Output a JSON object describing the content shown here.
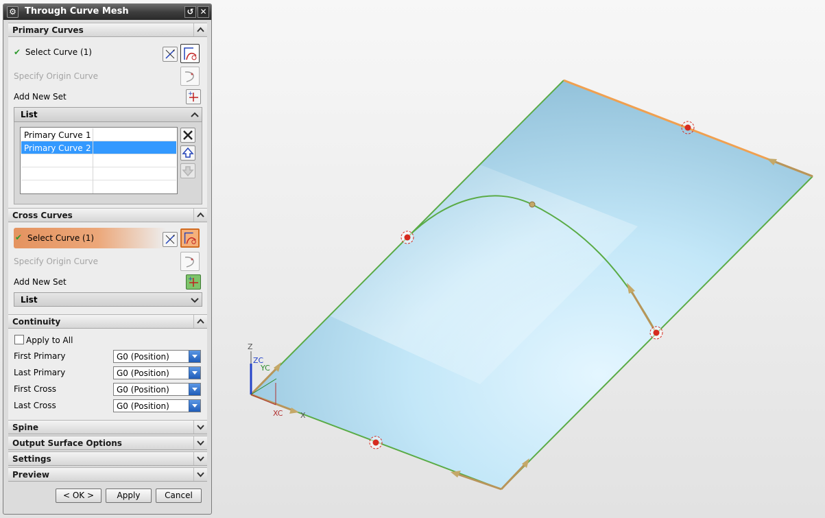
{
  "dialog": {
    "title": "Through Curve Mesh",
    "primary_curves": {
      "header": "Primary Curves",
      "select_curve": "Select Curve (1)",
      "specify_origin": "Specify Origin Curve",
      "add_new_set": "Add New Set",
      "list_header": "List",
      "list_rows": [
        {
          "name": "Primary Curve",
          "num": "1"
        },
        {
          "name": "Primary Curve",
          "num": "2"
        }
      ]
    },
    "cross_curves": {
      "header": "Cross Curves",
      "select_curve": "Select Curve (1)",
      "specify_origin": "Specify Origin Curve",
      "add_new_set": "Add New Set",
      "list_header": "List"
    },
    "continuity": {
      "header": "Continuity",
      "apply_all": "Apply to All",
      "rows": [
        {
          "label": "First Primary",
          "value": "G0 (Position)"
        },
        {
          "label": "Last Primary",
          "value": "G0 (Position)"
        },
        {
          "label": "First Cross",
          "value": "G0 (Position)"
        },
        {
          "label": "Last Cross",
          "value": "G0 (Position)"
        }
      ]
    },
    "collapsed_sections": [
      "Spine",
      "Output Surface Options",
      "Settings",
      "Preview"
    ],
    "buttons": {
      "ok": "< OK >",
      "apply": "Apply",
      "cancel": "Cancel"
    }
  },
  "viewport": {
    "axes": {
      "z": "Z",
      "zc": "ZC",
      "yc": "YC",
      "xc": "XC",
      "x": "X"
    },
    "colors": {
      "surface": "#bfe4f7",
      "edge": "#5aab46",
      "selected_edge": "#f0a050",
      "handle": "#d62b1f"
    }
  }
}
